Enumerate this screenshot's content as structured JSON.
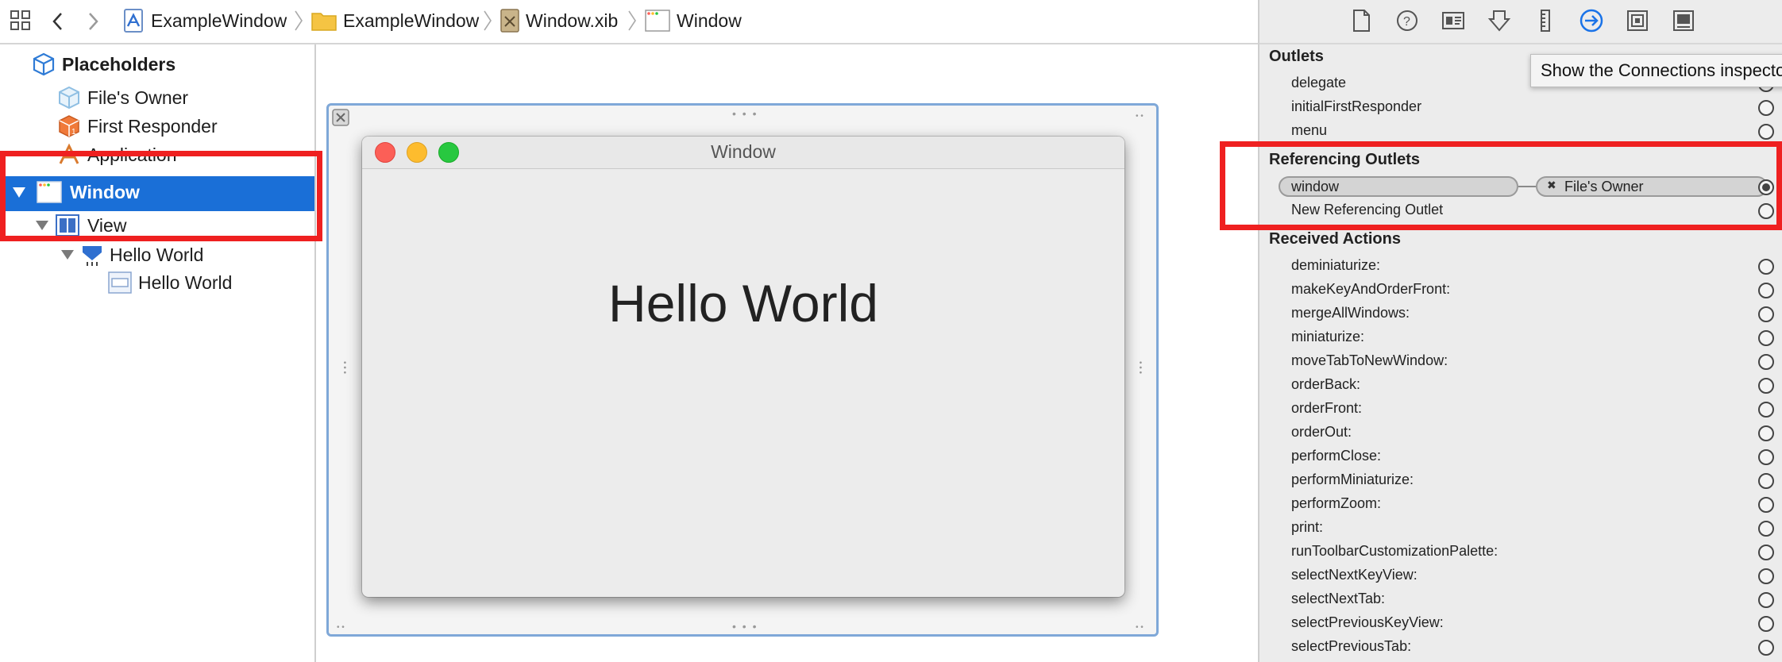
{
  "breadcrumb": {
    "items": [
      {
        "label": "ExampleWindow",
        "icon": "xcode-project-icon"
      },
      {
        "label": "ExampleWindow",
        "icon": "folder-icon"
      },
      {
        "label": "Window.xib",
        "icon": "xib-file-icon"
      },
      {
        "label": "Window",
        "icon": "window-icon"
      }
    ]
  },
  "navigator": {
    "placeholders_label": "Placeholders",
    "files_owner": "File's Owner",
    "first_responder": "First Responder",
    "application": "Application",
    "window": "Window",
    "view": "View",
    "hello_world_parent": "Hello World",
    "hello_world_child": "Hello World"
  },
  "canvas": {
    "window_title": "Window",
    "label_text": "Hello World"
  },
  "inspector": {
    "tooltip": "Show the Connections inspector",
    "outlets_title": "Outlets",
    "outlets": [
      "delegate",
      "initialFirstResponder",
      "menu"
    ],
    "referencing_title": "Referencing Outlets",
    "referencing_connection": {
      "outlet": "window",
      "target": "File's Owner"
    },
    "new_referencing": "New Referencing Outlet",
    "actions_title": "Received Actions",
    "actions": [
      "deminiaturize:",
      "makeKeyAndOrderFront:",
      "mergeAllWindows:",
      "miniaturize:",
      "moveTabToNewWindow:",
      "orderBack:",
      "orderFront:",
      "orderOut:",
      "performClose:",
      "performMiniaturize:",
      "performZoom:",
      "print:",
      "runToolbarCustomizationPalette:",
      "selectNextKeyView:",
      "selectNextTab:",
      "selectPreviousKeyView:",
      "selectPreviousTab:"
    ]
  },
  "colors": {
    "selection": "#1a6fd7",
    "highlight_box": "#ef2020",
    "connections_active": "#1a73e8"
  }
}
